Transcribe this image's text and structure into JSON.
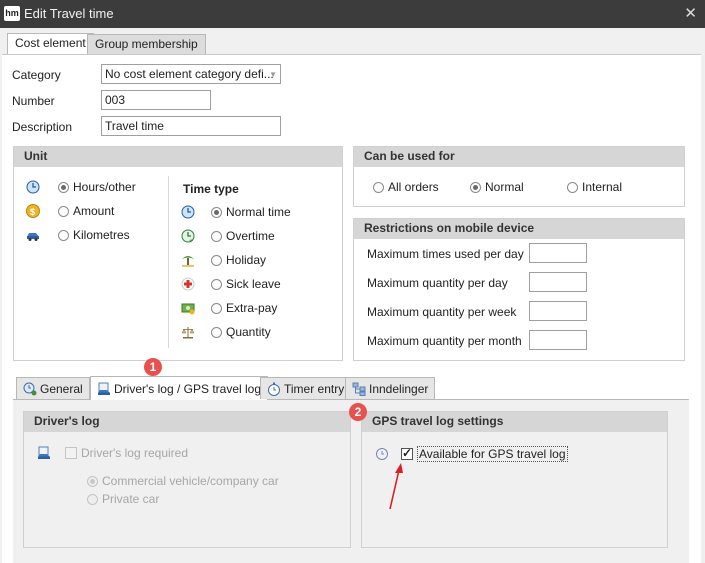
{
  "window": {
    "logo": "hm",
    "title": "Edit Travel time",
    "close": "✕"
  },
  "tabs": [
    {
      "label": "Cost element",
      "active": true
    },
    {
      "label": "Group membership",
      "active": false
    }
  ],
  "form": {
    "category_label": "Category",
    "category_value": "No cost element category defi...",
    "number_label": "Number",
    "number_value": "003",
    "description_label": "Description",
    "description_value": "Travel time"
  },
  "unit": {
    "title": "Unit",
    "options": [
      {
        "label": "Hours/other",
        "icon": "clock-icon",
        "selected": true
      },
      {
        "label": "Amount",
        "icon": "coin-icon",
        "selected": false
      },
      {
        "label": "Kilometres",
        "icon": "car-icon",
        "selected": false
      }
    ]
  },
  "time_type": {
    "title": "Time type",
    "options": [
      {
        "label": "Normal time",
        "icon": "clock-icon",
        "selected": true
      },
      {
        "label": "Overtime",
        "icon": "overtime-clock-icon",
        "selected": false
      },
      {
        "label": "Holiday",
        "icon": "palm-tree-icon",
        "selected": false
      },
      {
        "label": "Sick leave",
        "icon": "red-cross-icon",
        "selected": false
      },
      {
        "label": "Extra-pay",
        "icon": "money-icon",
        "selected": false
      },
      {
        "label": "Quantity",
        "icon": "scale-icon",
        "selected": false
      }
    ]
  },
  "usage": {
    "title": "Can be used for",
    "options": [
      {
        "label": "All orders",
        "selected": false
      },
      {
        "label": "Normal",
        "selected": true
      },
      {
        "label": "Internal",
        "selected": false
      }
    ]
  },
  "restrictions": {
    "title": "Restrictions on mobile device",
    "fields": [
      {
        "label": "Maximum times used per day",
        "value": ""
      },
      {
        "label": "Maximum quantity per day",
        "value": ""
      },
      {
        "label": "Maximum quantity per week",
        "value": ""
      },
      {
        "label": "Maximum quantity per month",
        "value": ""
      }
    ]
  },
  "bottom_tabs": [
    {
      "label": "General",
      "icon": "clock-person-icon",
      "active": false
    },
    {
      "label": "Driver's log / GPS travel log",
      "icon": "car-document-icon",
      "active": true
    },
    {
      "label": "Timer entry",
      "icon": "stopwatch-icon",
      "active": false
    },
    {
      "label": "Inndelinger",
      "icon": "hierarchy-icon",
      "active": false
    }
  ],
  "drivers_log": {
    "title": "Driver's log",
    "required_label": "Driver's log required",
    "required_checked": false,
    "vehicle_options": [
      {
        "label": "Commercial vehicle/company car",
        "selected": true
      },
      {
        "label": "Private car",
        "selected": false
      }
    ]
  },
  "gps": {
    "title": "GPS travel log settings",
    "available_label": "Available for GPS travel log",
    "available_checked": true
  },
  "annotations": {
    "badge_1": "1",
    "badge_2": "2",
    "arrow_color": "#e02020",
    "badge_color": "#e8514e"
  }
}
